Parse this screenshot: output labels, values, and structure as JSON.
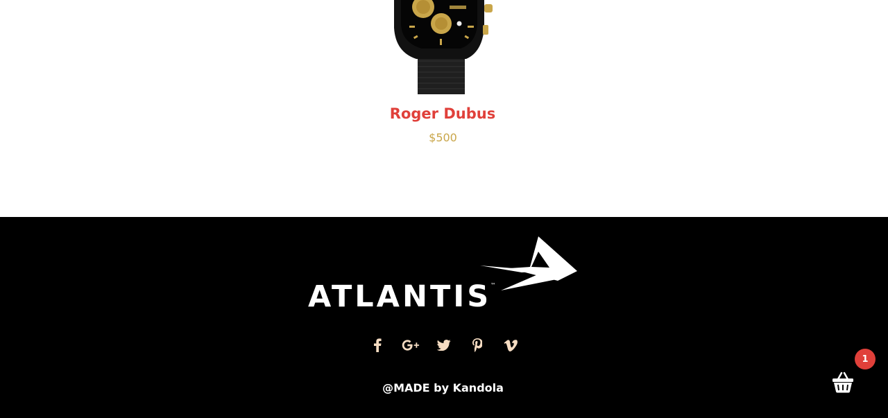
{
  "product": {
    "image_alt": "black and gold chronograph watch",
    "name": "Roger Dubus",
    "price": "$500"
  },
  "footer": {
    "logo_text": "ATLANTIS",
    "logo_tm": "™",
    "social": [
      {
        "name": "facebook-icon"
      },
      {
        "name": "google-plus-icon"
      },
      {
        "name": "twitter-icon"
      },
      {
        "name": "pinterest-icon"
      },
      {
        "name": "vimeo-icon"
      }
    ],
    "copyright": "@MADE by Kandola"
  },
  "cart": {
    "count": "1",
    "badge_color": "#e0403a"
  },
  "colors": {
    "accent": "#e0403a",
    "price": "#c9a64a",
    "footer_bg": "#000000",
    "icon": "#f5dcc2"
  }
}
